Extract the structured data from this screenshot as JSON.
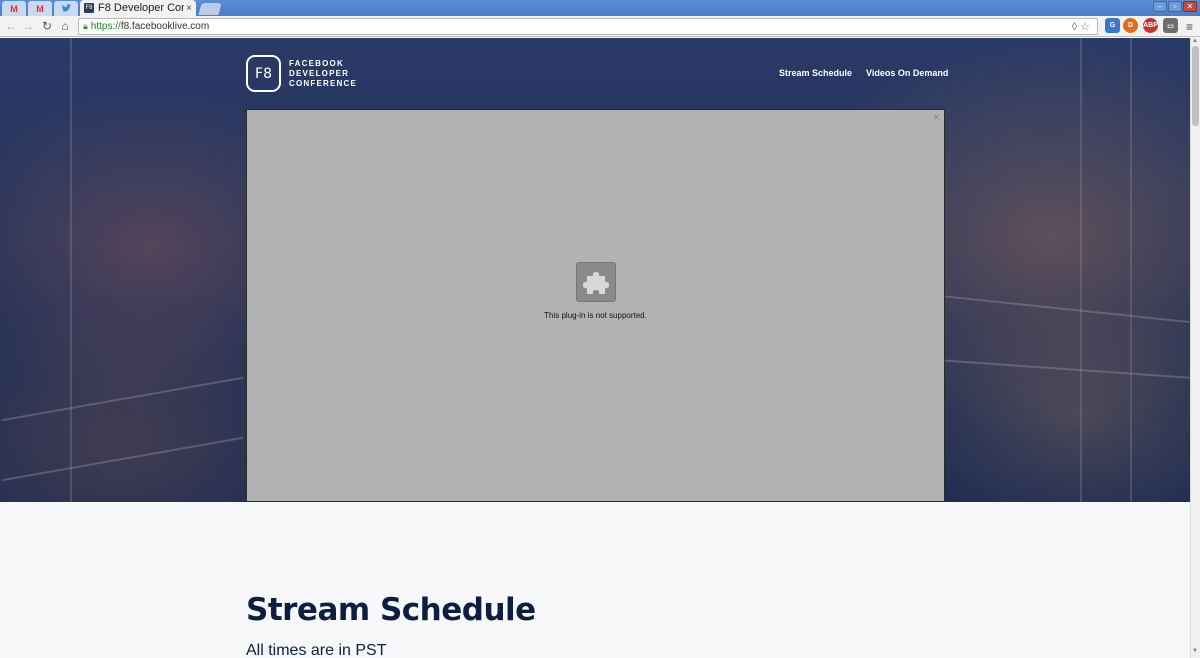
{
  "browser": {
    "tab_title": "F8 Developer Con",
    "tab_favicon": "F8",
    "tab_close": "×",
    "url_protocol": "https://",
    "url_host": "f8.facebooklive.com",
    "pinned_tabs": [
      "gmail-icon",
      "gmail-icon",
      "twitter-icon"
    ],
    "extensions": [
      "translate-icon",
      "duckduckgo-icon",
      "adblock-plus-icon",
      "screenshot-icon"
    ],
    "window_controls": [
      "–",
      "▫",
      "✕"
    ]
  },
  "page": {
    "logo_text": "F8",
    "brand_lines": [
      "FACEBOOK",
      "DEVELOPER",
      "CONFERENCE"
    ],
    "nav": [
      {
        "label": "Stream Schedule"
      },
      {
        "label": "Videos On Demand"
      }
    ],
    "player": {
      "close": "×",
      "plugin_message": "This plug-in is not supported.",
      "plugin_icon": "puzzle-piece-icon"
    },
    "schedule": {
      "title": "Stream Schedule",
      "subtitle": "All times are in PST"
    }
  },
  "colors": {
    "hero_bg": "#233159",
    "heading": "#0e1e3f",
    "player_bg": "#b3b3b3"
  }
}
